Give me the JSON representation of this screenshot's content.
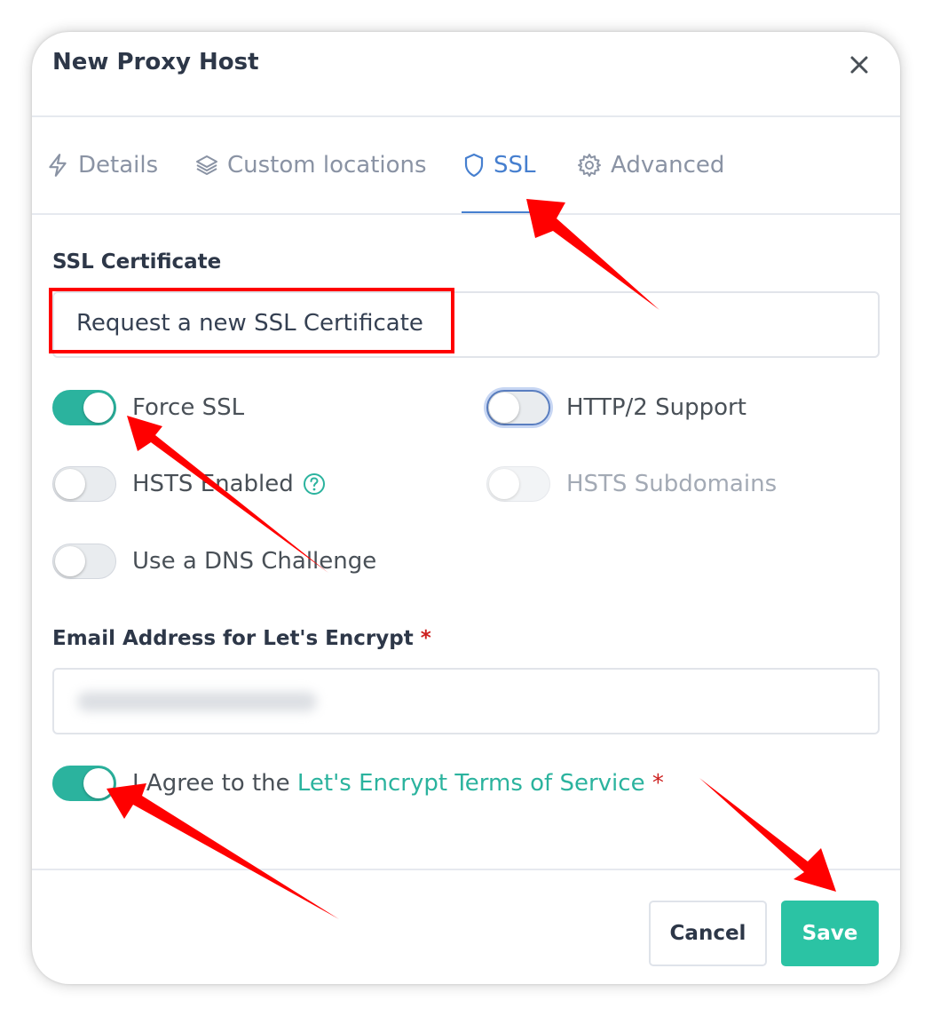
{
  "dialog": {
    "title": "New Proxy Host"
  },
  "tabs": [
    {
      "label": "Details",
      "icon": "lightning-icon",
      "active": false
    },
    {
      "label": "Custom locations",
      "icon": "layers-icon",
      "active": false
    },
    {
      "label": "SSL",
      "icon": "shield-icon",
      "active": true
    },
    {
      "label": "Advanced",
      "icon": "gear-icon",
      "active": false
    }
  ],
  "ssl": {
    "certificate_label": "SSL Certificate",
    "certificate_value": "Request a new SSL Certificate",
    "toggles": {
      "force_ssl": {
        "label": "Force SSL",
        "on": true
      },
      "http2": {
        "label": "HTTP/2 Support",
        "on": false
      },
      "hsts": {
        "label": "HSTS Enabled",
        "on": false
      },
      "hsts_subdomains": {
        "label": "HSTS Subdomains",
        "on": false,
        "disabled": true
      },
      "dns_challenge": {
        "label": "Use a DNS Challenge",
        "on": false
      }
    },
    "email_label": "Email Address for Let's Encrypt",
    "required_mark": "*",
    "agree": {
      "prefix": "I Agree to the",
      "link": "Let's Encrypt Terms of Service",
      "on": true
    }
  },
  "footer": {
    "cancel_label": "Cancel",
    "save_label": "Save"
  },
  "colors": {
    "accent": "#2bb39e",
    "active_tab": "#467fcf",
    "annotation": "#ff0000",
    "required": "#cd201f"
  }
}
